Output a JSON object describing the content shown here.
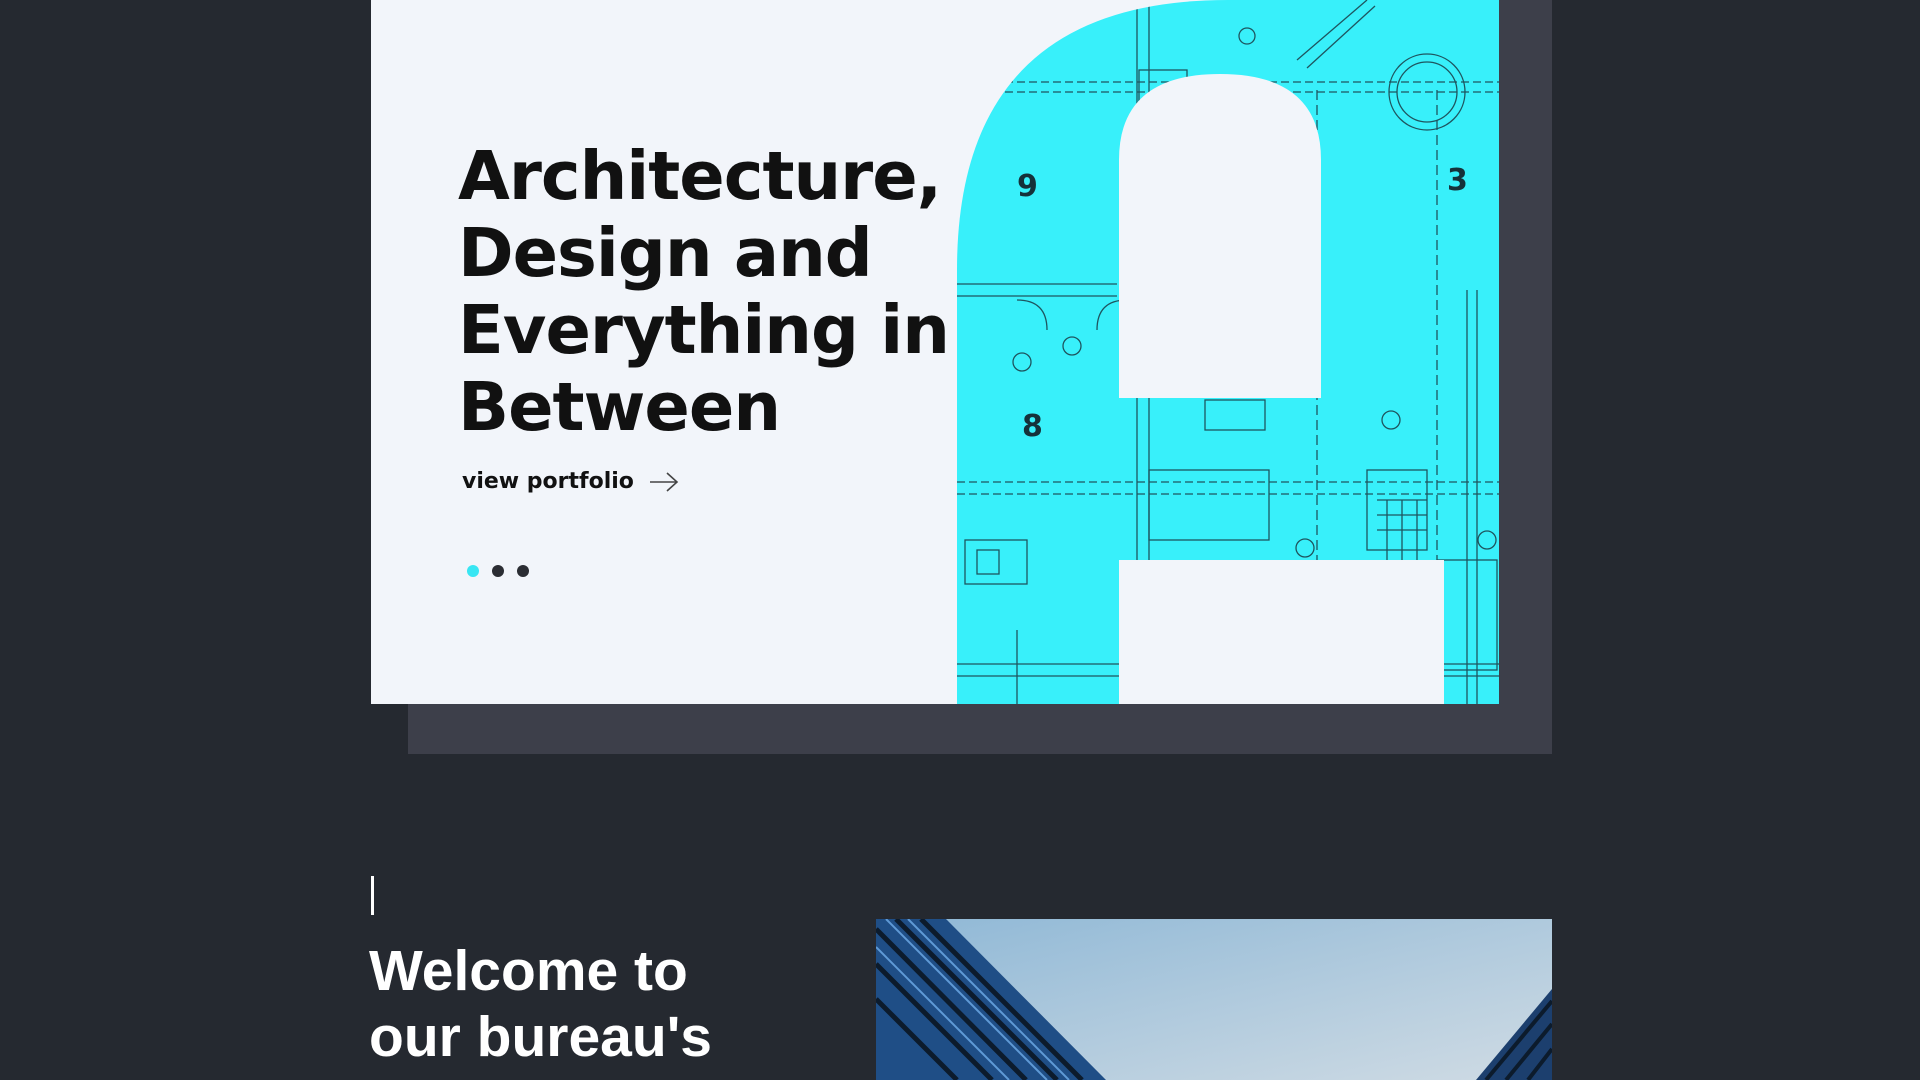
{
  "hero": {
    "title": "Architecture, Design and Everything in Between",
    "link_label": "view portfolio",
    "link_icon": "arrow-right-icon",
    "slider": {
      "count": 3,
      "active_index": 0
    },
    "room_numbers": [
      "9",
      "3",
      "8"
    ],
    "accent_color": "#38e6f3"
  },
  "welcome": {
    "bold": "Welcome",
    "rest_line1": " to",
    "line2": "our bureau's"
  }
}
